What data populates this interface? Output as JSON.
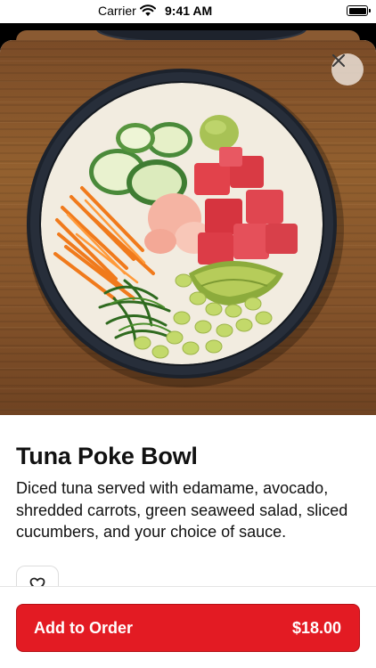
{
  "status_bar": {
    "carrier": "Carrier",
    "time": "9:41 AM",
    "wifi_icon": "wifi-icon",
    "battery_icon": "battery-icon"
  },
  "product": {
    "image_icon": "tuna-poke-bowl-photo",
    "close_icon": "close-icon",
    "name": "Tuna Poke Bowl",
    "description": "Diced tuna served with edamame, avocado, shredded carrots, green seaweed salad, sliced cucumbers, and your choice of sauce.",
    "favorite_icon": "heart-icon"
  },
  "order_button": {
    "label": "Add to Order",
    "price": "$18.00"
  },
  "colors": {
    "accent": "#e31b23",
    "text": "#111111",
    "wood": "#8a5a32"
  }
}
